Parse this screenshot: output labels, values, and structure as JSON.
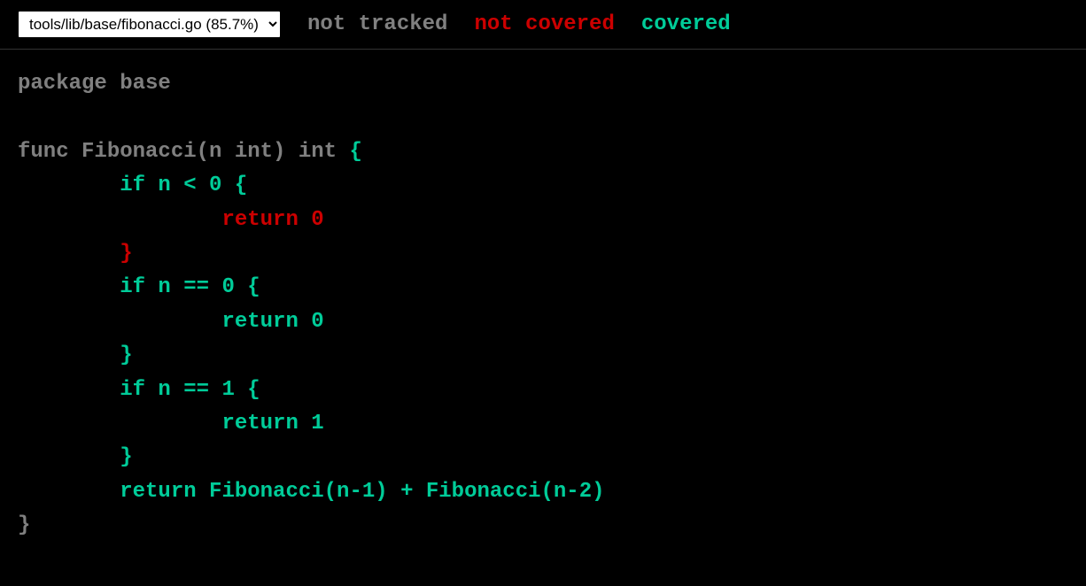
{
  "header": {
    "file_select": "tools/lib/base/fibonacci.go (85.7%)",
    "legend": {
      "not_tracked": "not tracked",
      "not_covered": "not covered",
      "covered": "covered"
    }
  },
  "code": {
    "line1": "package base",
    "line2": "",
    "line3_part1": "func Fibonacci(n int) int ",
    "line3_part2": "{",
    "line4": "        if n < 0 {",
    "line5": "                return 0",
    "line6": "        }",
    "line7": "        if n == 0 {",
    "line8": "                return 0",
    "line9": "        }",
    "line10": "        if n == 1 {",
    "line11": "                return 1",
    "line12": "        }",
    "line13": "        return Fibonacci(n-1) + Fibonacci(n-2)",
    "line14": "}"
  }
}
